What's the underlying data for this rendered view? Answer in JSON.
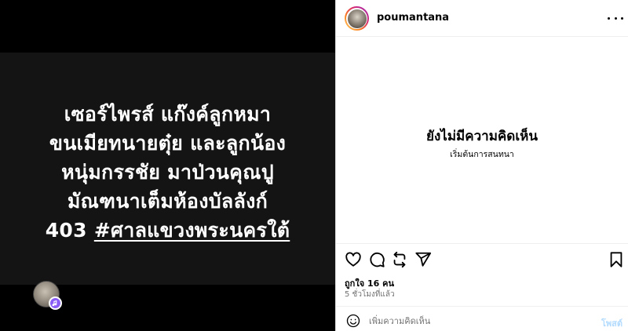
{
  "media": {
    "caption_lines": [
      "เซอร์ไพรส์ แก๊งค์ลูกหมา",
      "ขนเมียทนายตุ๋ย และลูกน้อง",
      "หนุ่มกรรชัย มาป่วนคุณปู",
      "มัณฑนาเต็มห้องบัลลังก์"
    ],
    "last_line_prefix": "403 ",
    "hashtag": "#ศาลแขวงพระนครใต้",
    "badge_icon": "music-note-icon"
  },
  "header": {
    "username": "poumantana",
    "more_icon": "more-horizontal-icon"
  },
  "comments": {
    "empty_title": "ยังไม่มีความคิดเห็น",
    "empty_subtitle": "เริ่มต้นการสนทนา"
  },
  "actions": {
    "icons": [
      "heart-icon",
      "comment-icon",
      "share-icon",
      "send-icon",
      "bookmark-icon"
    ]
  },
  "stats": {
    "likes": "ถูกใจ 16 คน",
    "time": "5 ชั่วโมงที่แล้ว"
  },
  "composer": {
    "placeholder": "เพิ่มความคิดเห็น",
    "post_label": "โพสต์"
  },
  "colors": {
    "post_button_disabled": "#b3dbff",
    "media_background": "#141414",
    "badge": "#8a5cf6"
  }
}
